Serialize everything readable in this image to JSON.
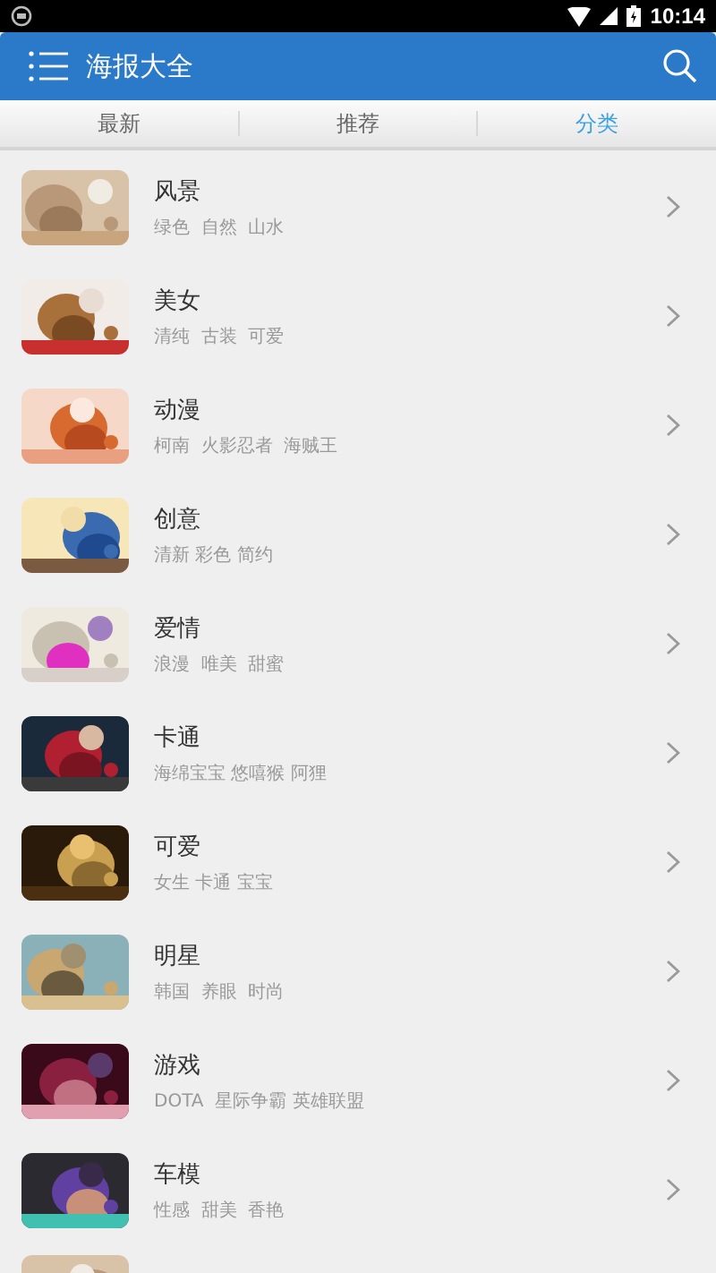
{
  "status_bar": {
    "time": "10:14"
  },
  "app_bar": {
    "title": "海报大全"
  },
  "tabs": [
    {
      "label": "最新",
      "selected": false
    },
    {
      "label": "推荐",
      "selected": false
    },
    {
      "label": "分类",
      "selected": true
    }
  ],
  "categories": [
    {
      "title": "风景",
      "tags": "绿色  自然  山水"
    },
    {
      "title": "美女",
      "tags": "清纯  古装  可爱"
    },
    {
      "title": "动漫",
      "tags": "柯南  火影忍者  海贼王"
    },
    {
      "title": "创意",
      "tags": "清新 彩色 简约"
    },
    {
      "title": "爱情",
      "tags": "浪漫  唯美  甜蜜"
    },
    {
      "title": "卡通",
      "tags": "海绵宝宝 悠嘻猴 阿狸"
    },
    {
      "title": "可爱",
      "tags": "女生 卡通 宝宝"
    },
    {
      "title": "明星",
      "tags": "韩国  养眼  时尚"
    },
    {
      "title": "游戏",
      "tags": "DOTA  星际争霸 英雄联盟"
    },
    {
      "title": "车模",
      "tags": "性感  甜美  香艳"
    }
  ]
}
